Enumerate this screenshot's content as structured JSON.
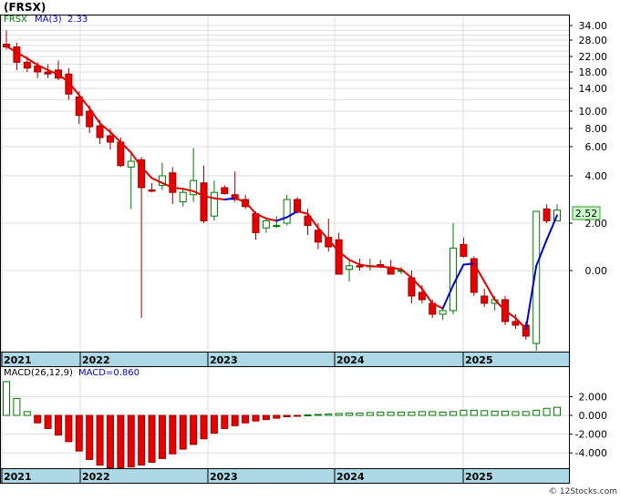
{
  "chart_data": [
    {
      "type": "candlestick",
      "ticker": "(FRSX)",
      "legend": {
        "symbol": "FRSX",
        "ma_label": "MA(3)",
        "ma_value": "2.33"
      },
      "last_price_label": "2.52",
      "y_tick_labels": [
        "34.00",
        "28.00",
        "22.00",
        "18.00",
        "14.00",
        "10.00",
        "8.00",
        "6.00",
        "4.00",
        "2.00",
        "0.00"
      ],
      "x_tick_labels": [
        "2021",
        "2022",
        "2023",
        "2024",
        "2025"
      ],
      "y_scale": "logarithmic (price axis, labels shown as printed)",
      "grid": true,
      "colors": {
        "bull_body": "#ffffff",
        "bull_edge": "#007700",
        "bear_body": "#e80000",
        "ma_rising": "#0000cc",
        "ma_falling": "#e00000",
        "date_band": "#add8e6"
      },
      "candles": [
        {
          "o": 26.5,
          "h": 32.0,
          "l": 24.5,
          "c": 25.5
        },
        {
          "o": 25.5,
          "h": 27.0,
          "l": 18.5,
          "c": 20.5
        },
        {
          "o": 20.5,
          "h": 22.0,
          "l": 18.0,
          "c": 19.0
        },
        {
          "o": 19.5,
          "h": 20.5,
          "l": 16.5,
          "c": 18.0
        },
        {
          "o": 18.0,
          "h": 20.0,
          "l": 16.5,
          "c": 17.5
        },
        {
          "o": 18.5,
          "h": 21.0,
          "l": 16.0,
          "c": 16.5
        },
        {
          "o": 17.5,
          "h": 19.0,
          "l": 12.0,
          "c": 13.0
        },
        {
          "o": 12.5,
          "h": 13.5,
          "l": 8.5,
          "c": 9.5
        },
        {
          "o": 10.0,
          "h": 11.0,
          "l": 7.5,
          "c": 8.2
        },
        {
          "o": 8.3,
          "h": 9.0,
          "l": 6.3,
          "c": 7.0
        },
        {
          "o": 7.2,
          "h": 8.0,
          "l": 5.8,
          "c": 6.5
        },
        {
          "o": 6.5,
          "h": 7.0,
          "l": 4.6,
          "c": 4.7
        },
        {
          "o": 4.6,
          "h": 5.5,
          "l": 2.6,
          "c": 5.0
        },
        {
          "o": 5.1,
          "h": 5.3,
          "l": -0.65,
          "c": 3.5
        },
        {
          "o": 3.4,
          "h": 3.7,
          "l": 3.3,
          "c": 3.35
        },
        {
          "o": 3.6,
          "h": 4.9,
          "l": 3.4,
          "c": 4.0
        },
        {
          "o": 4.2,
          "h": 4.6,
          "l": 2.8,
          "c": 3.3
        },
        {
          "o": 2.9,
          "h": 3.5,
          "l": 2.7,
          "c": 3.3
        },
        {
          "o": 3.2,
          "h": 5.9,
          "l": 2.9,
          "c": 3.8
        },
        {
          "o": 3.7,
          "h": 4.7,
          "l": 2.0,
          "c": 2.1
        },
        {
          "o": 2.3,
          "h": 3.8,
          "l": 2.1,
          "c": 3.3
        },
        {
          "o": 3.5,
          "h": 3.6,
          "l": 3.2,
          "c": 3.25
        },
        {
          "o": 3.2,
          "h": 4.3,
          "l": 2.9,
          "c": 3.0
        },
        {
          "o": 3.0,
          "h": 3.2,
          "l": 2.6,
          "c": 2.7
        },
        {
          "o": 2.4,
          "h": 2.5,
          "l": 1.3,
          "c": 1.6
        },
        {
          "o": 1.8,
          "h": 2.2,
          "l": 1.6,
          "c": 2.1
        },
        {
          "o": 1.9,
          "h": 2.3,
          "l": 1.8,
          "c": 1.9
        },
        {
          "o": 2.0,
          "h": 3.2,
          "l": 1.9,
          "c": 3.0
        },
        {
          "o": 3.0,
          "h": 3.1,
          "l": 2.4,
          "c": 2.5
        },
        {
          "o": 2.3,
          "h": 2.6,
          "l": 1.5,
          "c": 1.9
        },
        {
          "o": 1.7,
          "h": 2.0,
          "l": 0.9,
          "c": 1.2
        },
        {
          "o": 1.4,
          "h": 2.2,
          "l": 0.8,
          "c": 1.0
        },
        {
          "o": 1.3,
          "h": 1.6,
          "l": -0.05,
          "c": -0.05
        },
        {
          "o": 0.05,
          "h": 0.4,
          "l": -0.15,
          "c": 0.2
        },
        {
          "o": 0.2,
          "h": 0.5,
          "l": 0.0,
          "c": 0.15
        },
        {
          "o": 0.2,
          "h": 0.5,
          "l": 0.0,
          "c": 0.2
        },
        {
          "o": 0.25,
          "h": 0.45,
          "l": 0.1,
          "c": 0.15
        },
        {
          "o": 0.15,
          "h": 0.45,
          "l": -0.05,
          "c": -0.05
        },
        {
          "o": 0.0,
          "h": 0.15,
          "l": -0.05,
          "c": 0.0
        },
        {
          "o": -0.1,
          "h": 0.0,
          "l": -0.45,
          "c": -0.35
        },
        {
          "o": -0.3,
          "h": -0.2,
          "l": -0.45,
          "c": -0.4
        },
        {
          "o": -0.45,
          "h": -0.4,
          "l": -0.65,
          "c": -0.6
        },
        {
          "o": -0.6,
          "h": -0.5,
          "l": -0.68,
          "c": -0.55
        },
        {
          "o": -0.55,
          "h": 2.0,
          "l": -0.6,
          "c": 0.95
        },
        {
          "o": 1.1,
          "h": 1.4,
          "l": 0.55,
          "c": 0.6
        },
        {
          "o": 0.5,
          "h": 0.6,
          "l": -0.35,
          "c": -0.3
        },
        {
          "o": -0.35,
          "h": -0.25,
          "l": -0.5,
          "c": -0.45
        },
        {
          "o": -0.45,
          "h": -0.35,
          "l": -0.55,
          "c": -0.4
        },
        {
          "o": -0.4,
          "h": -0.35,
          "l": -0.75,
          "c": -0.7
        },
        {
          "o": -0.7,
          "h": -0.6,
          "l": -0.8,
          "c": -0.75
        },
        {
          "o": -0.75,
          "h": -0.7,
          "l": -0.95,
          "c": -0.9
        },
        {
          "o": -1.0,
          "h": 2.4,
          "l": -1.1,
          "c": 2.5
        },
        {
          "o": 2.6,
          "h": 2.8,
          "l": 2.0,
          "c": 2.1
        },
        {
          "o": 2.1,
          "h": 2.8,
          "l": 2.1,
          "c": 2.55
        }
      ],
      "ma_values": [
        25.8,
        23.5,
        21.5,
        19.8,
        18.5,
        17.4,
        15.5,
        12.8,
        10.5,
        8.6,
        7.6,
        6.5,
        5.6,
        4.6,
        3.9,
        3.7,
        3.5,
        3.45,
        3.35,
        3.15,
        3.05,
        3.0,
        3.05,
        2.9,
        2.4,
        2.2,
        2.1,
        2.25,
        2.5,
        2.4,
        1.8,
        1.3,
        0.8,
        0.45,
        0.25,
        0.18,
        0.17,
        0.12,
        0.05,
        -0.1,
        -0.25,
        -0.45,
        -0.52,
        -0.2,
        0.25,
        0.3,
        -0.15,
        -0.4,
        -0.55,
        -0.65,
        -0.8,
        0.2,
        1.3,
        2.33
      ]
    },
    {
      "type": "bar",
      "legend": {
        "label": "MACD(26,12,9)",
        "value_label": "MACD=0.860"
      },
      "y_tick_labels": [
        "2.000",
        "0.000",
        "-2.000",
        "-4.000"
      ],
      "x_tick_labels": [
        "2021",
        "2022",
        "2023",
        "2024",
        "2025"
      ],
      "ylim": [
        -5.8,
        3.8
      ],
      "values": [
        3.6,
        1.8,
        0.4,
        -0.8,
        -1.4,
        -2.1,
        -2.8,
        -3.8,
        -4.7,
        -5.3,
        -5.6,
        -5.6,
        -5.5,
        -5.3,
        -5.0,
        -4.6,
        -4.1,
        -3.6,
        -3.1,
        -2.5,
        -1.9,
        -1.4,
        -1.1,
        -0.8,
        -0.6,
        -0.45,
        -0.3,
        -0.15,
        -0.05,
        0.05,
        0.1,
        0.15,
        0.2,
        0.25,
        0.25,
        0.3,
        0.35,
        0.35,
        0.35,
        0.35,
        0.4,
        0.4,
        0.35,
        0.4,
        0.55,
        0.55,
        0.5,
        0.45,
        0.45,
        0.4,
        0.4,
        0.55,
        0.75,
        0.86
      ],
      "colors": {
        "positive_edge": "#007700",
        "negative_body": "#e80000"
      }
    }
  ],
  "watermark": "© 12Stocks.com"
}
